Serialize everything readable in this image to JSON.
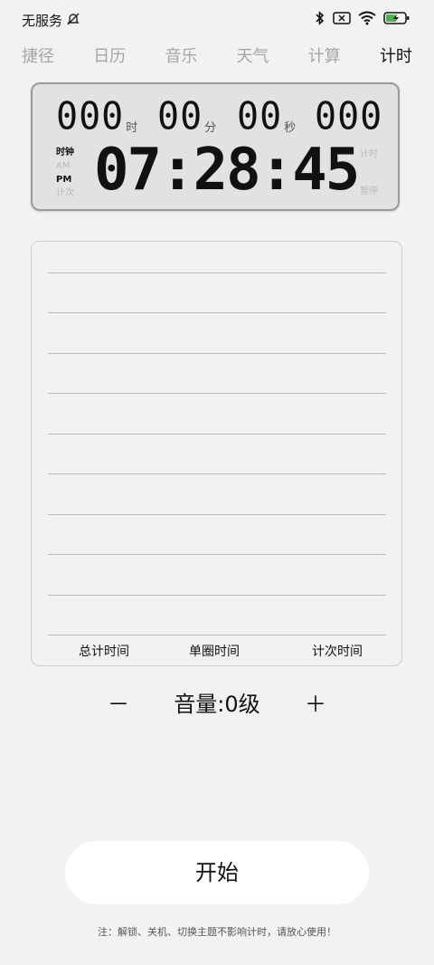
{
  "status": {
    "network": "无服务"
  },
  "tabs": [
    {
      "label": "捷径",
      "active": false
    },
    {
      "label": "日历",
      "active": false
    },
    {
      "label": "音乐",
      "active": false
    },
    {
      "label": "天气",
      "active": false
    },
    {
      "label": "计算",
      "active": false
    },
    {
      "label": "计时",
      "active": true
    }
  ],
  "clock": {
    "hours": "000",
    "hours_unit": "时",
    "minutes": "00",
    "minutes_unit": "分",
    "seconds": "00",
    "seconds_unit": "秒",
    "millis": "000",
    "mode_clock": "时钟",
    "am": "AM",
    "pm": "PM",
    "mode_count": "计次",
    "timing": "计时",
    "paused": "暂停",
    "time": "07:28:45"
  },
  "laps": {
    "rows": 10,
    "headers": [
      "总计时间",
      "单圈时间",
      "计次时间"
    ]
  },
  "volume": {
    "minus": "－",
    "label": "音量:0级",
    "plus": "＋"
  },
  "start_label": "开始",
  "note": "注：解锁、关机、切换主题不影响计时，请放心使用！"
}
